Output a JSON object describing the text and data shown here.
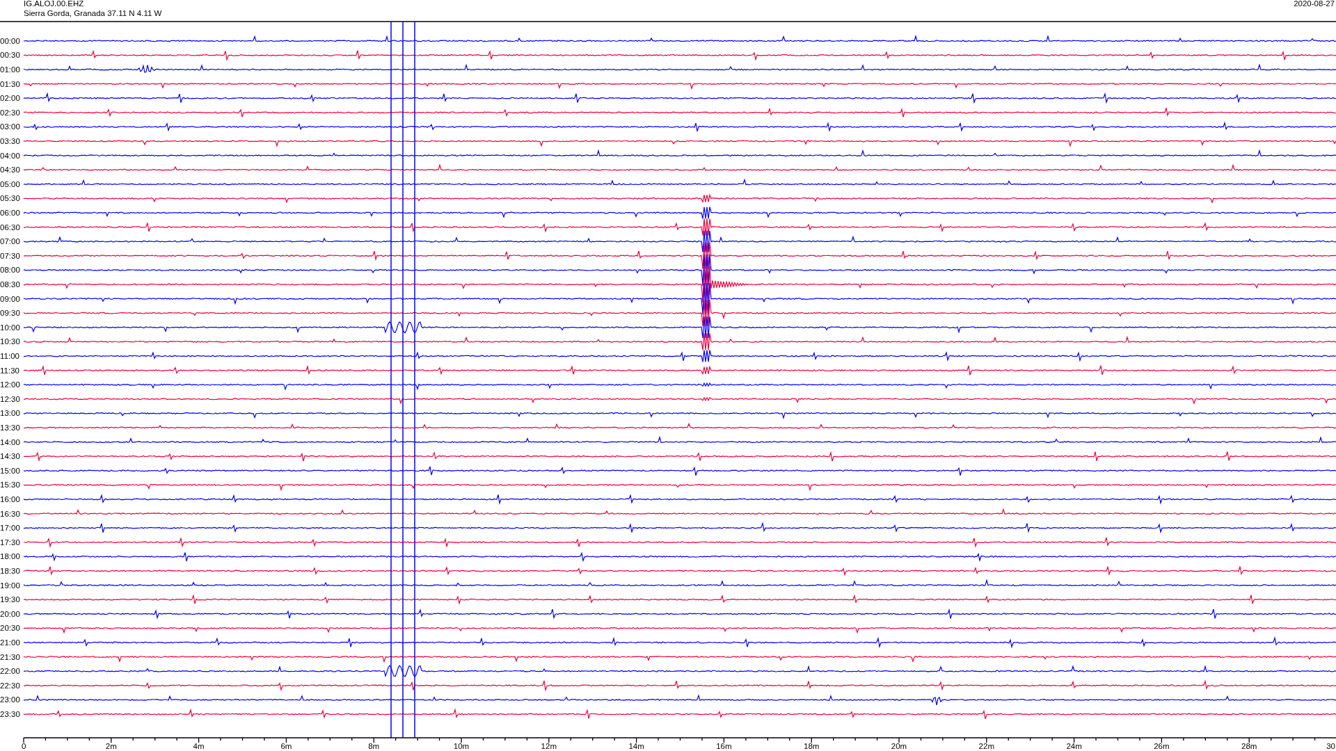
{
  "header": {
    "station": "IG.ALOJ.00.EHZ",
    "location": "Sierra Gorda, Granada  37.11 N 4.11 W",
    "date": "2020-08-27"
  },
  "rows": [
    {
      "time": "00:00",
      "color": "#0000ff"
    },
    {
      "time": "00:30",
      "color": "#f0003c"
    },
    {
      "time": "01:00",
      "color": "#0000ff"
    },
    {
      "time": "01:30",
      "color": "#f0003c"
    },
    {
      "time": "02:00",
      "color": "#0000ff"
    },
    {
      "time": "02:30",
      "color": "#f0003c"
    },
    {
      "time": "03:00",
      "color": "#0000ff"
    },
    {
      "time": "03:30",
      "color": "#f0003c"
    },
    {
      "time": "04:00",
      "color": "#0000ff"
    },
    {
      "time": "04:30",
      "color": "#f0003c"
    },
    {
      "time": "05:00",
      "color": "#0000ff"
    },
    {
      "time": "05:30",
      "color": "#f0003c"
    },
    {
      "time": "06:00",
      "color": "#0000ff"
    },
    {
      "time": "06:30",
      "color": "#f0003c"
    },
    {
      "time": "07:00",
      "color": "#0000ff"
    },
    {
      "time": "07:30",
      "color": "#f0003c"
    },
    {
      "time": "08:00",
      "color": "#0000ff"
    },
    {
      "time": "08:30",
      "color": "#f0003c"
    },
    {
      "time": "09:00",
      "color": "#0000ff"
    },
    {
      "time": "09:30",
      "color": "#f0003c"
    },
    {
      "time": "10:00",
      "color": "#0000ff"
    },
    {
      "time": "10:30",
      "color": "#f0003c"
    },
    {
      "time": "11:00",
      "color": "#0000ff"
    },
    {
      "time": "11:30",
      "color": "#f0003c"
    },
    {
      "time": "12:00",
      "color": "#0000ff"
    },
    {
      "time": "12:30",
      "color": "#f0003c"
    },
    {
      "time": "13:00",
      "color": "#0000ff"
    },
    {
      "time": "13:30",
      "color": "#f0003c"
    },
    {
      "time": "14:00",
      "color": "#0000ff"
    },
    {
      "time": "14:30",
      "color": "#f0003c"
    },
    {
      "time": "15:00",
      "color": "#0000ff"
    },
    {
      "time": "15:30",
      "color": "#f0003c"
    },
    {
      "time": "16:00",
      "color": "#0000ff"
    },
    {
      "time": "16:30",
      "color": "#f0003c"
    },
    {
      "time": "17:00",
      "color": "#0000ff"
    },
    {
      "time": "17:30",
      "color": "#f0003c"
    },
    {
      "time": "18:00",
      "color": "#0000ff"
    },
    {
      "time": "18:30",
      "color": "#f0003c"
    },
    {
      "time": "19:00",
      "color": "#0000ff"
    },
    {
      "time": "19:30",
      "color": "#f0003c"
    },
    {
      "time": "20:00",
      "color": "#0000ff"
    },
    {
      "time": "20:30",
      "color": "#f0003c"
    },
    {
      "time": "21:00",
      "color": "#0000ff"
    },
    {
      "time": "21:30",
      "color": "#f0003c"
    },
    {
      "time": "22:00",
      "color": "#0000ff"
    },
    {
      "time": "22:30",
      "color": "#f0003c"
    },
    {
      "time": "23:00",
      "color": "#0000ff"
    },
    {
      "time": "23:30",
      "color": "#f0003c"
    }
  ],
  "x_axis": {
    "ticks": [
      "0",
      "2m",
      "4m",
      "6m",
      "8m",
      "10m",
      "12m",
      "14m",
      "16m",
      "18m",
      "20m",
      "22m",
      "24m",
      "26m",
      "28m",
      "30"
    ]
  }
}
